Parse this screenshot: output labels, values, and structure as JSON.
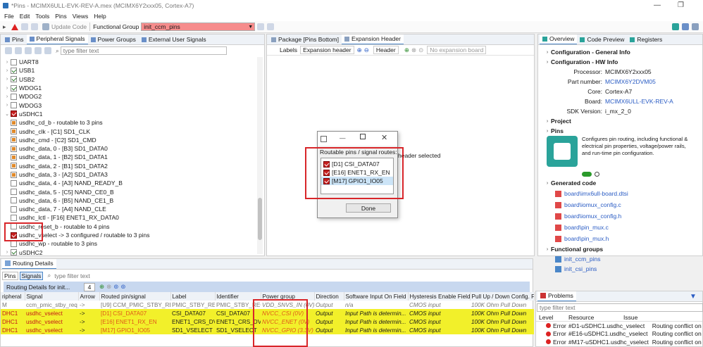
{
  "title": "*Pins - MCIMX6ULL-EVK-REV-A.mex (MCIMX6Y2xxx05, Cortex-A7)",
  "menu": [
    "File",
    "Edit",
    "Tools",
    "Pins",
    "Views",
    "Help"
  ],
  "toolbar": {
    "update_code": "Update Code",
    "functional_group_label": "Functional Group",
    "functional_group_value": "init_ccm_pins"
  },
  "left_tabs": [
    "Pins",
    "Peripheral Signals",
    "Power Groups",
    "External User Signals"
  ],
  "left_filter_placeholder": "type filter text",
  "tree": [
    {
      "label": "UART8",
      "level": 0,
      "state": "off",
      "twist": ">"
    },
    {
      "label": "USB1",
      "level": 0,
      "state": "on",
      "twist": ">"
    },
    {
      "label": "USB2",
      "level": 0,
      "state": "on",
      "twist": ">"
    },
    {
      "label": "WDOG1",
      "level": 0,
      "state": "on",
      "twist": ">"
    },
    {
      "label": "WDOG2",
      "level": 0,
      "state": "off",
      "twist": ">"
    },
    {
      "label": "WDOG3",
      "level": 0,
      "state": "off",
      "twist": ">"
    },
    {
      "label": "uSDHC1",
      "level": 0,
      "state": "err",
      "twist": "v"
    },
    {
      "label": "usdhc_cd_b - routable to 3 pins",
      "level": 1,
      "state": "part"
    },
    {
      "label": "usdhc_clk - [C1] SD1_CLK",
      "level": 1,
      "state": "part"
    },
    {
      "label": "usdhc_cmd - [C2] SD1_CMD",
      "level": 1,
      "state": "part"
    },
    {
      "label": "usdhc_data, 0 - [B3] SD1_DATA0",
      "level": 1,
      "state": "part"
    },
    {
      "label": "usdhc_data, 1 - [B2] SD1_DATA1",
      "level": 1,
      "state": "part"
    },
    {
      "label": "usdhc_data, 2 - [B1] SD1_DATA2",
      "level": 1,
      "state": "part"
    },
    {
      "label": "usdhc_data, 3 - [A2] SD1_DATA3",
      "level": 1,
      "state": "part"
    },
    {
      "label": "usdhc_data, 4 - [A3] NAND_READY_B",
      "level": 1,
      "state": "off"
    },
    {
      "label": "usdhc_data, 5 - [C5] NAND_CE0_B",
      "level": 1,
      "state": "off"
    },
    {
      "label": "usdhc_data, 6 - [B5] NAND_CE1_B",
      "level": 1,
      "state": "off"
    },
    {
      "label": "usdhc_data, 7 - [A4] NAND_CLE",
      "level": 1,
      "state": "off"
    },
    {
      "label": "usdhc_lctl - [F16] ENET1_RX_DATA0",
      "level": 1,
      "state": "off"
    },
    {
      "label": "usdhc_reset_b - routable to 4 pins",
      "level": 1,
      "state": "off"
    },
    {
      "label": "usdhc_vselect -> 3 configured / routable to 3 pins",
      "level": 1,
      "state": "err"
    },
    {
      "label": "usdhc_wp - routable to 3 pins",
      "level": 1,
      "state": "off"
    },
    {
      "label": "uSDHC2",
      "level": 0,
      "state": "on",
      "twist": ">"
    }
  ],
  "center_tabs": [
    "Package [Pins Bottom]",
    "Expansion Header"
  ],
  "center_toolbar": {
    "labels": "Labels",
    "labels_value": "Expansion header",
    "header": "Header",
    "no_board": "No expansion board"
  },
  "center_msg": "header selected",
  "dialog": {
    "heading": "Routable pins / signal routes:",
    "items": [
      "[D1] CSI_DATA07",
      "[E16] ENET1_RX_EN",
      "[M17] GPIO1_IO05"
    ],
    "done": "Done"
  },
  "right_tabs": [
    "Overview",
    "Code Preview",
    "Registers"
  ],
  "overview": {
    "general": "Configuration - General Info",
    "hw": "Configuration - HW Info",
    "fields": [
      {
        "k": "Processor:",
        "v": "MCIMX6Y2xxx05",
        "link": false
      },
      {
        "k": "Part number:",
        "v": "MCIMX6Y2DVM05",
        "link": true
      },
      {
        "k": "Core:",
        "v": "Cortex-A7",
        "link": false
      },
      {
        "k": "Board:",
        "v": "MCIMX6ULL-EVK-REV-A",
        "link": true
      },
      {
        "k": "SDK Version:",
        "v": "i_mx_2_0",
        "link": false
      }
    ],
    "project": "Project",
    "pins": "Pins",
    "pins_desc": "Configures pin routing, including functional & electrical pin properties, voltage/power rails, and run-time pin configuration.",
    "generated": "Generated code",
    "files": [
      "board\\imx6ull-board.dtsi",
      "board\\iomux_config.c",
      "board\\iomux_config.h",
      "board\\pin_mux.c",
      "board\\pin_mux.h"
    ],
    "fg": "Functional groups",
    "groups": [
      "init_ccm_pins",
      "init_csi_pins"
    ]
  },
  "routing": {
    "title": "Routing Details",
    "tabs": [
      "Pins",
      "Signals"
    ],
    "filter": "type filter text",
    "for": "Routing Details for init...",
    "count": "4",
    "columns": [
      "ripheral",
      "Signal",
      "Arrow",
      "Routed pin/signal",
      "Label",
      "Identifier",
      "Power group",
      "Direction",
      "Software Input On Field",
      "Hysteresis Enable Field",
      "Pull Up / Down Config. F"
    ],
    "rows": [
      {
        "style": "grey",
        "cells": [
          "M",
          "ccm_pmic_stby_req",
          "->",
          "[U9] CCM_PMIC_STBY_REQ",
          "PMIC_STBY_REQ",
          "PMIC_STBY_REQ",
          "VDD_SNVS_IN (0V)",
          "Output",
          "n/a",
          "CMOS input",
          "100K Ohm Pull Down"
        ]
      },
      {
        "style": "yel",
        "cells": [
          "DHC1",
          "usdhc_vselect",
          "->",
          "[D1] CSI_DATA07",
          "CSI_DATA07",
          "CSI_DATA07",
          "NVCC_CSI (0V)",
          "Output",
          "Input Path is determin...",
          "CMOS input",
          "100K Ohm Pull Down"
        ]
      },
      {
        "style": "yel",
        "cells": [
          "DHC1",
          "usdhc_vselect",
          "->",
          "[E16] ENET1_RX_EN",
          "ENET1_CRS_DV",
          "ENET1_CRS_DV",
          "NVCC_ENET (0V)",
          "Output",
          "Input Path is determin...",
          "CMOS input",
          "100K Ohm Pull Down"
        ]
      },
      {
        "style": "yel",
        "cells": [
          "DHC1",
          "usdhc_vselect",
          "->",
          "[M17] GPIO1_IO05",
          "SD1_VSELECT",
          "SD1_VSELECT",
          "NVCC_GPIO (3.3V)",
          "Output",
          "Input Path is determin...",
          "CMOS input",
          "100K Ohm Pull Down"
        ]
      }
    ]
  },
  "problems": {
    "title": "Problems",
    "filter": "type filter text",
    "columns": [
      "Level",
      "Resource",
      "Issue"
    ],
    "rows": [
      {
        "level": "Error",
        "res": "#D1-uSDHC1.usdhc_vselect",
        "issue": "Routing conflict on 'E"
      },
      {
        "level": "Error",
        "res": "#E16-uSDHC1.usdhc_vselect",
        "issue": "Routing conflict on 'E"
      },
      {
        "level": "Error",
        "res": "#M17-uSDHC1.usdhc_vselect",
        "issue": "Routing conflict on 'E"
      }
    ]
  }
}
